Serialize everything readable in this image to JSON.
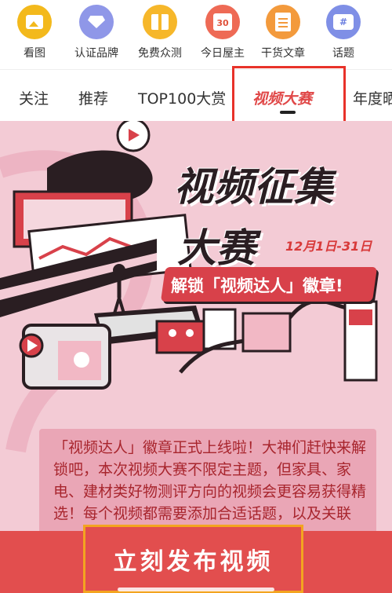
{
  "icon_row": [
    {
      "label": "看图",
      "icon": "image-icon",
      "color": "#f3b91c"
    },
    {
      "label": "认证品牌",
      "icon": "diamond-icon",
      "color": "#8f97e8"
    },
    {
      "label": "免费众测",
      "icon": "gift-icon",
      "color": "#f6b72a"
    },
    {
      "label": "今日屋主",
      "icon": "calendar-icon",
      "color": "#ee6a55",
      "badge": "30"
    },
    {
      "label": "干货文章",
      "icon": "document-icon",
      "color": "#f39a3c"
    },
    {
      "label": "话题",
      "icon": "hashtag-icon",
      "color": "#7f8fe6",
      "badge": "#"
    }
  ],
  "tabs": [
    {
      "label": "关注",
      "active": false
    },
    {
      "label": "推荐",
      "active": false
    },
    {
      "label": "TOP100大赏",
      "active": false
    },
    {
      "label": "视频大赛",
      "active": true
    },
    {
      "label": "年度晒",
      "active": false
    }
  ],
  "banner": {
    "headline_line1": "视频征集",
    "headline_line2": "大赛",
    "date": "12月1日-31日",
    "unlock": "解锁「视频达人」徽章!",
    "description": "「视频达人」徽章正式上线啦！大神们赶快来解锁吧，本次视频大赛不限定主题，但家具、家电、建材类好物测评方向的视频会更容易获得精选！每个视频都需要添加合适话题，以及关联",
    "background_color": "#f3cbd5",
    "accent_color": "#d8414a"
  },
  "publish_button": {
    "label": "立刻发布视频",
    "color": "#e24e4e",
    "highlight_color": "#f3a420"
  },
  "highlight_color": "#e8322a"
}
